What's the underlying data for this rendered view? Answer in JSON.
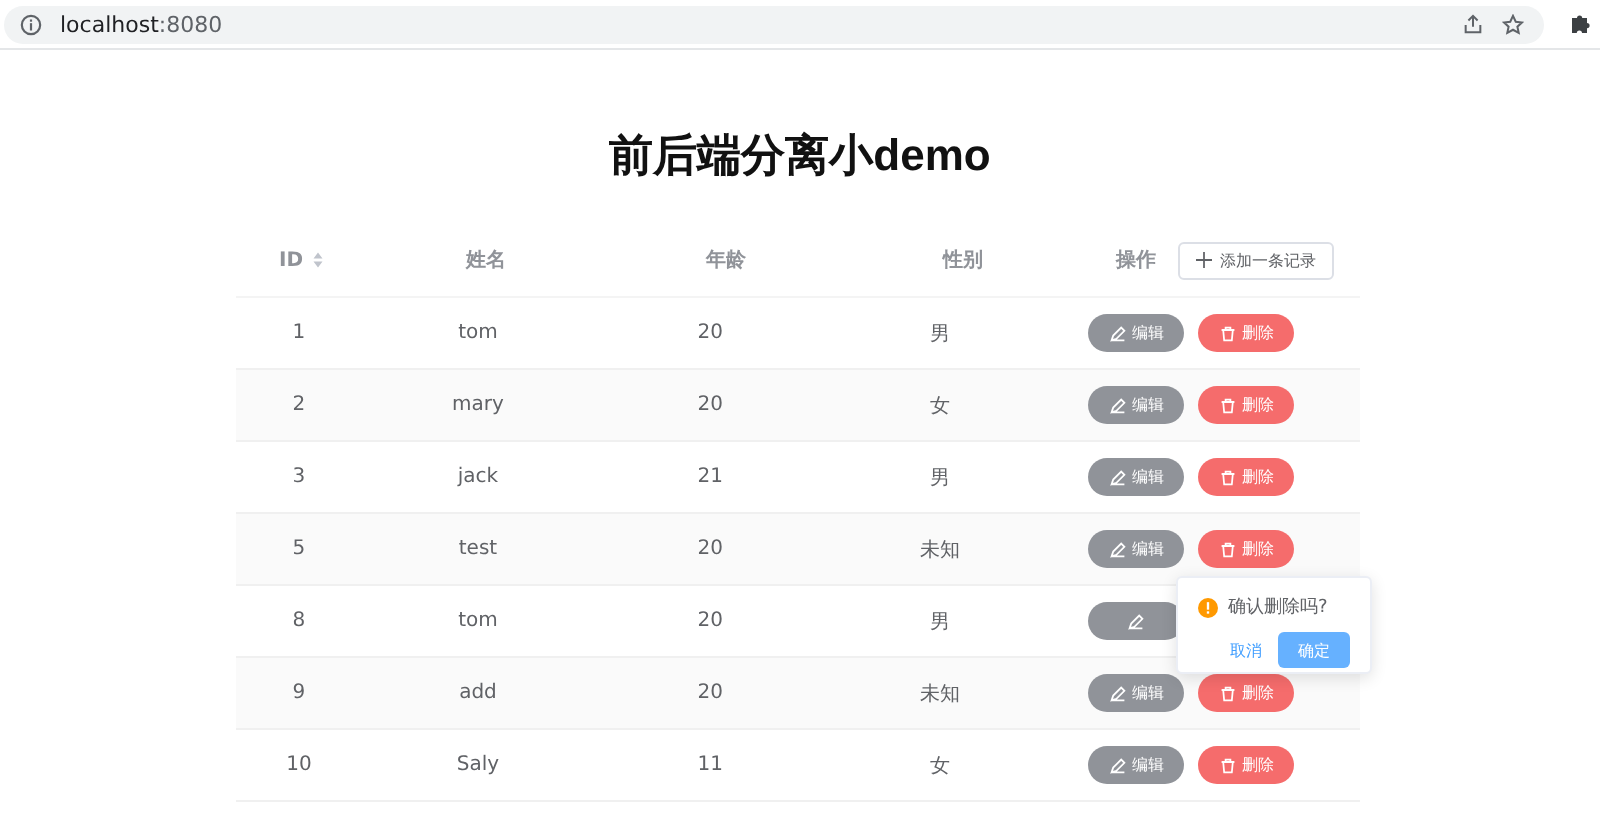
{
  "browser": {
    "host": "localhost",
    "port": ":8080"
  },
  "page": {
    "title": "前后端分离小demo"
  },
  "table": {
    "columns": [
      {
        "label": "ID",
        "sortable": true
      },
      {
        "label": "姓名",
        "sortable": false
      },
      {
        "label": "年龄",
        "sortable": false
      },
      {
        "label": "性别",
        "sortable": false
      },
      {
        "label": "操作",
        "sortable": false
      }
    ],
    "add_button": "添加一条记录",
    "rows": [
      {
        "id": "1",
        "name": "tom",
        "age": "20",
        "gender": "男",
        "actions": [
          {
            "kind": "edit",
            "label": "编辑"
          },
          {
            "kind": "delete",
            "label": "删除"
          }
        ]
      },
      {
        "id": "2",
        "name": "mary",
        "age": "20",
        "gender": "女",
        "actions": [
          {
            "kind": "edit",
            "label": "编辑"
          },
          {
            "kind": "delete",
            "label": "删除"
          }
        ]
      },
      {
        "id": "3",
        "name": "jack",
        "age": "21",
        "gender": "男",
        "actions": [
          {
            "kind": "edit",
            "label": "编辑"
          },
          {
            "kind": "delete",
            "label": "删除"
          }
        ]
      },
      {
        "id": "5",
        "name": "test",
        "age": "20",
        "gender": "未知",
        "actions": [
          {
            "kind": "edit",
            "label": "编辑"
          },
          {
            "kind": "delete",
            "label": "删除"
          }
        ]
      },
      {
        "id": "8",
        "name": "tom",
        "age": "20",
        "gender": "男",
        "actions": [
          {
            "kind": "edit"
          }
        ]
      },
      {
        "id": "9",
        "name": "add",
        "age": "20",
        "gender": "未知",
        "actions": [
          {
            "kind": "edit",
            "label": "编辑"
          },
          {
            "kind": "delete",
            "label": "删除"
          }
        ]
      },
      {
        "id": "10",
        "name": "Saly",
        "age": "11",
        "gender": "女",
        "actions": [
          {
            "kind": "edit",
            "label": "编辑"
          },
          {
            "kind": "delete",
            "label": "删除"
          }
        ]
      }
    ]
  },
  "popconfirm": {
    "message": "确认删除吗?",
    "cancel": "取消",
    "confirm": "确定"
  }
}
